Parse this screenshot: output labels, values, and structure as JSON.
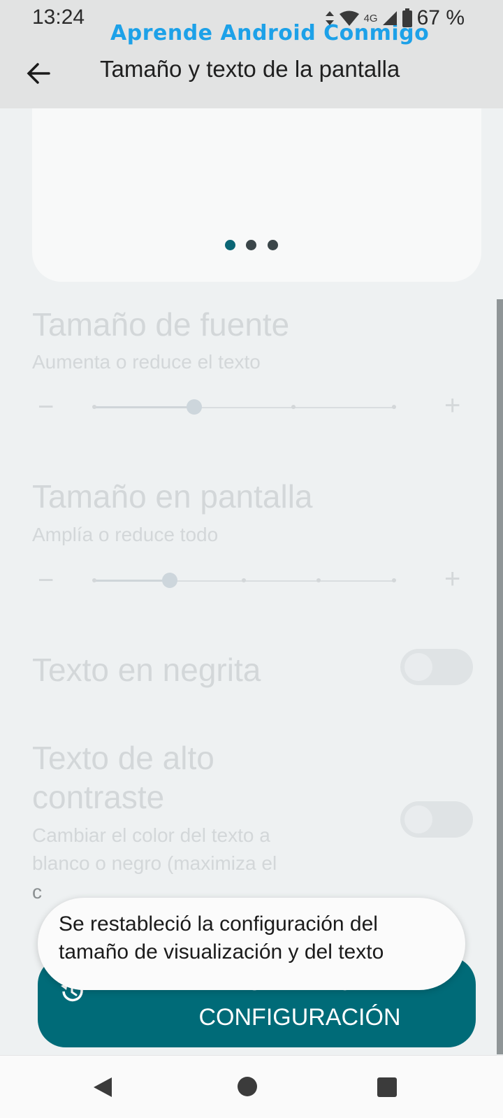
{
  "status_bar": {
    "time": "13:24",
    "network": "4G",
    "battery": "67 %"
  },
  "watermark": "Aprende Android Conmigo",
  "header": {
    "title": "Tamaño y texto de la pantalla",
    "back_icon": "arrow-left-icon"
  },
  "preview": {
    "pages": 3,
    "active_page": 1
  },
  "font_size": {
    "title": "Tamaño de fuente",
    "subtitle": "Aumenta o reduce el texto",
    "minus": "−",
    "plus": "+",
    "steps": 4,
    "selected_step": 2
  },
  "display_size": {
    "title": "Tamaño en pantalla",
    "subtitle": "Amplía o reduce todo",
    "minus": "−",
    "plus": "+",
    "steps": 5,
    "selected_step": 2
  },
  "bold_text": {
    "title": "Texto en negrita",
    "enabled": false
  },
  "high_contrast": {
    "title_line1": "Texto de alto",
    "title_line2": "contraste",
    "subtitle_line1": "Cambiar el color del texto a",
    "subtitle_line2": "blanco o negro (maximiza el",
    "subtitle_line3_visible": "c",
    "enabled": false
  },
  "reset_button": {
    "label_line1": "RESTABLECER",
    "label_line2": "CONFIGURACIÓN",
    "icon": "restore-history-icon"
  },
  "toast": {
    "line1": "Se restableció la configuración del",
    "line2": "tamaño de visualización y del texto"
  },
  "nav_bar": {
    "back_icon": "triangle-back-icon",
    "home_icon": "circle-home-icon",
    "recents_icon": "square-recents-icon"
  },
  "colors": {
    "accent": "#006b78",
    "active_dot": "#0b6675",
    "inactive_dot": "#3b4649"
  }
}
